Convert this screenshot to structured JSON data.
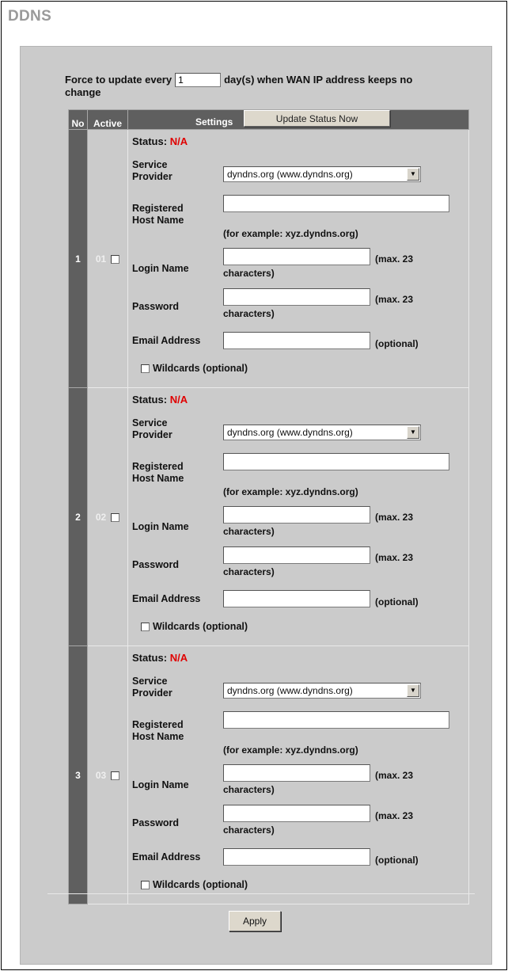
{
  "page": {
    "title": "DDNS"
  },
  "force_update": {
    "label_before": "Force to update every",
    "days_value": "1",
    "label_after": "day(s) when WAN IP address keeps no",
    "label_wrap": "change"
  },
  "table": {
    "headers": {
      "no": "No",
      "active": "Active",
      "settings": "Settings"
    },
    "update_status_button": "Update Status Now"
  },
  "entries": [
    {
      "no": "1",
      "index": "01",
      "status_label": "Status:",
      "status_value": "N/A",
      "service_provider_label_1": "Service",
      "service_provider_label_2": "Provider",
      "service_provider_value": "dyndns.org (www.dyndns.org)",
      "host_label_1": "Registered",
      "host_label_2": "Host Name",
      "host_value": "",
      "host_example": "(for example: xyz.dyndns.org)",
      "login_label": "Login Name",
      "login_value": "",
      "password_label": "Password",
      "password_value": "",
      "max_note_1": "(max. 23",
      "max_note_2": "characters)",
      "email_label": "Email Address",
      "email_value": "",
      "email_note": "(optional)",
      "wildcards_label": "Wildcards (optional)"
    },
    {
      "no": "2",
      "index": "02",
      "status_label": "Status:",
      "status_value": "N/A",
      "service_provider_label_1": "Service",
      "service_provider_label_2": "Provider",
      "service_provider_value": "dyndns.org (www.dyndns.org)",
      "host_label_1": "Registered",
      "host_label_2": "Host Name",
      "host_value": "",
      "host_example": "(for example: xyz.dyndns.org)",
      "login_label": "Login Name",
      "login_value": "",
      "password_label": "Password",
      "password_value": "",
      "max_note_1": "(max. 23",
      "max_note_2": "characters)",
      "email_label": "Email Address",
      "email_value": "",
      "email_note": "(optional)",
      "wildcards_label": "Wildcards (optional)"
    },
    {
      "no": "3",
      "index": "03",
      "status_label": "Status:",
      "status_value": "N/A",
      "service_provider_label_1": "Service",
      "service_provider_label_2": "Provider",
      "service_provider_value": "dyndns.org (www.dyndns.org)",
      "host_label_1": "Registered",
      "host_label_2": "Host Name",
      "host_value": "",
      "host_example": "(for example: xyz.dyndns.org)",
      "login_label": "Login Name",
      "login_value": "",
      "password_label": "Password",
      "password_value": "",
      "max_note_1": "(max. 23",
      "max_note_2": "characters)",
      "email_label": "Email Address",
      "email_value": "",
      "email_note": "(optional)",
      "wildcards_label": "Wildcards (optional)"
    }
  ],
  "footer": {
    "apply_button": "Apply"
  },
  "colors": {
    "header_bg": "#5f5f5f",
    "panel_bg": "#cbcbcb",
    "status_na": "#e00000"
  }
}
